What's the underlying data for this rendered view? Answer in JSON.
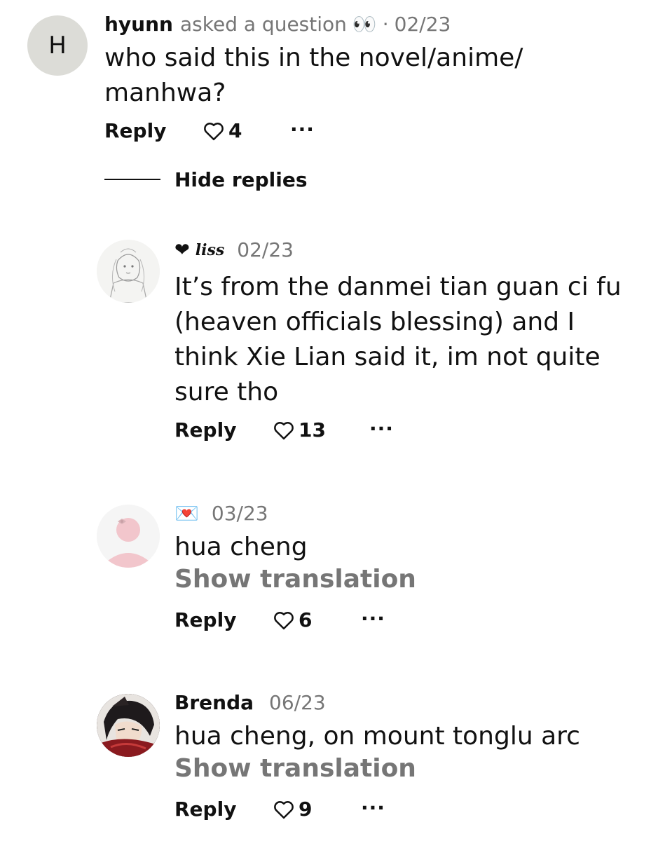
{
  "comments": [
    {
      "avatar_letter": "H",
      "author": "hyunn",
      "subtitle": "asked a question",
      "emoji": "👀",
      "separator": "·",
      "date": "02/23",
      "text": "who said this in the novel/anime/ manhwa?",
      "reply_label": "Reply",
      "likes": "4",
      "more": "···"
    },
    {
      "author_prefix": "❤",
      "author": "liss",
      "date": "02/23",
      "text": "It’s from the danmei tian guan ci fu (heaven officials blessing) and I think Xie Lian said it, im not quite sure tho",
      "reply_label": "Reply",
      "likes": "13",
      "more": "···"
    },
    {
      "author": "💌",
      "date": "03/23",
      "text": "hua cheng",
      "show_translation": "Show translation",
      "reply_label": "Reply",
      "likes": "6",
      "more": "···"
    },
    {
      "author": "Brenda",
      "date": "06/23",
      "text": "hua cheng, on mount tonglu arc",
      "show_translation": "Show translation",
      "reply_label": "Reply",
      "likes": "9",
      "more": "···"
    }
  ],
  "hide_replies_label": "Hide replies",
  "colors": {
    "text": "#111111",
    "muted": "#767676",
    "avatar_bg": "#dcdcd7",
    "pink_avatar": "#f2c6cc"
  }
}
